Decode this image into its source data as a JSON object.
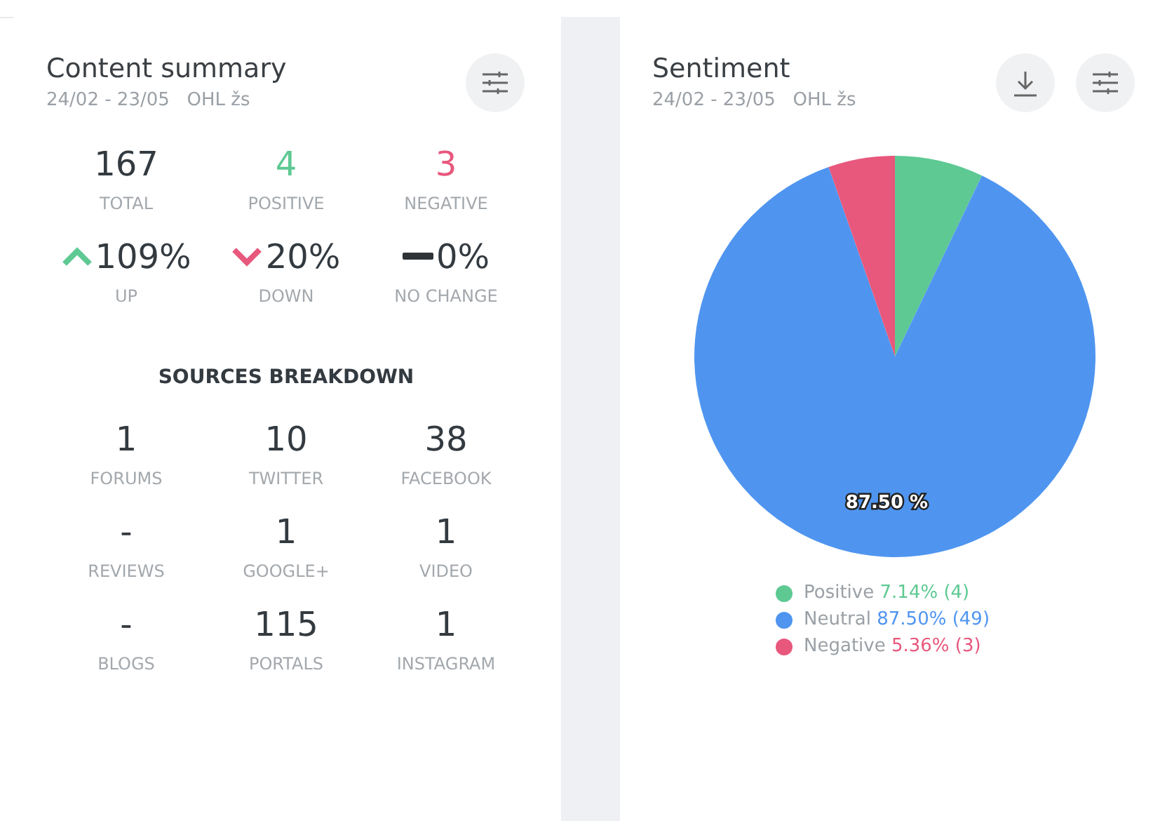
{
  "summary_card": {
    "title": "Content summary",
    "subtitle": "24/02 - 23/05   OHL žs",
    "stats": [
      {
        "value": "167",
        "label": "TOTAL",
        "color": "#333a40"
      },
      {
        "value": "4",
        "label": "POSITIVE",
        "color": "#5ec993"
      },
      {
        "value": "3",
        "label": "NEGATIVE",
        "color": "#e8577c"
      }
    ],
    "trends": [
      {
        "kind": "up",
        "value": "109%",
        "label": "UP"
      },
      {
        "kind": "down",
        "value": "20%",
        "label": "DOWN"
      },
      {
        "kind": "flat",
        "value": "0%",
        "label": "NO CHANGE"
      }
    ],
    "sources_heading": "SOURCES BREAKDOWN",
    "sources": [
      {
        "value": "1",
        "label": "FORUMS"
      },
      {
        "value": "10",
        "label": "TWITTER"
      },
      {
        "value": "38",
        "label": "FACEBOOK"
      },
      {
        "value": "-",
        "label": "REVIEWS"
      },
      {
        "value": "1",
        "label": "GOOGLE+"
      },
      {
        "value": "1",
        "label": "VIDEO"
      },
      {
        "value": "-",
        "label": "BLOGS"
      },
      {
        "value": "115",
        "label": "PORTALS"
      },
      {
        "value": "1",
        "label": "INSTAGRAM"
      }
    ]
  },
  "sentiment_card": {
    "title": "Sentiment",
    "subtitle": "24/02 - 23/05   OHL žs",
    "chart_data": {
      "type": "pie",
      "categories": [
        "Positive",
        "Neutral",
        "Negative"
      ],
      "values": [
        7.14,
        87.5,
        5.36
      ],
      "annotations": [
        {
          "x": "Neutral",
          "text": "87.50 %"
        }
      ]
    },
    "legend": [
      {
        "value": "7.14% (4)",
        "color": "#5ec993"
      },
      {
        "value": "87.50% (49)",
        "color": "#4f95f0"
      },
      {
        "value": "5.36% (3)",
        "color": "#e8577c"
      }
    ]
  }
}
